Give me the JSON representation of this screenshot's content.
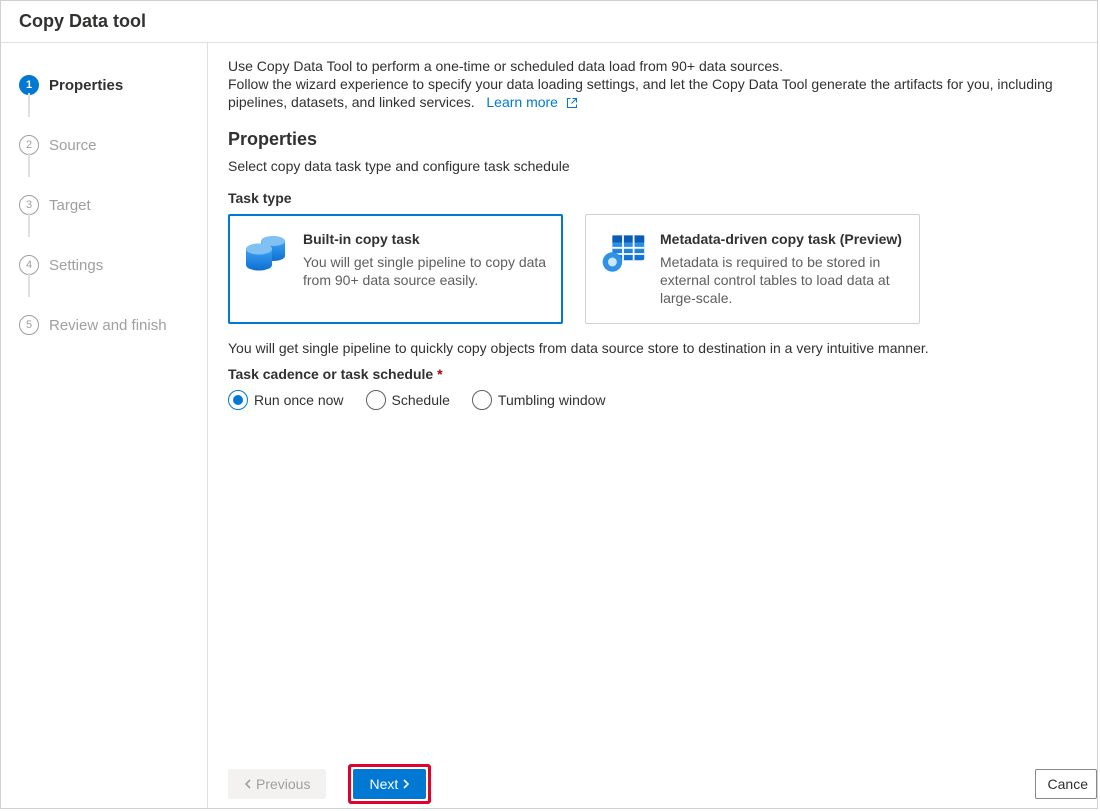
{
  "title": "Copy Data tool",
  "sidebar": {
    "steps": [
      {
        "num": "1",
        "label": "Properties"
      },
      {
        "num": "2",
        "label": "Source"
      },
      {
        "num": "3",
        "label": "Target"
      },
      {
        "num": "4",
        "label": "Settings"
      },
      {
        "num": "5",
        "label": "Review and finish"
      }
    ]
  },
  "intro": {
    "line1": "Use Copy Data Tool to perform a one-time or scheduled data load from 90+ data sources.",
    "line2": "Follow the wizard experience to specify your data loading settings, and let the Copy Data Tool generate the artifacts for you, including pipelines, datasets, and linked services.",
    "learn_more": "Learn more"
  },
  "section_title": "Properties",
  "section_subtitle": "Select copy data task type and configure task schedule",
  "task_type_label": "Task type",
  "cards": [
    {
      "title": "Built-in copy task",
      "desc": "You will get single pipeline to copy data from 90+ data source easily."
    },
    {
      "title": "Metadata-driven copy task (Preview)",
      "desc": "Metadata is required to be stored in external control tables to load data at large-scale."
    }
  ],
  "selected_card_desc": "You will get single pipeline to quickly copy objects from data source store to destination in a very intuitive manner.",
  "cadence_label_text": "Task cadence or task schedule",
  "cadence_required": "*",
  "radios": [
    {
      "label": "Run once now"
    },
    {
      "label": "Schedule"
    },
    {
      "label": "Tumbling window"
    }
  ],
  "footer": {
    "previous": "Previous",
    "next": "Next",
    "cancel": "Cance"
  }
}
